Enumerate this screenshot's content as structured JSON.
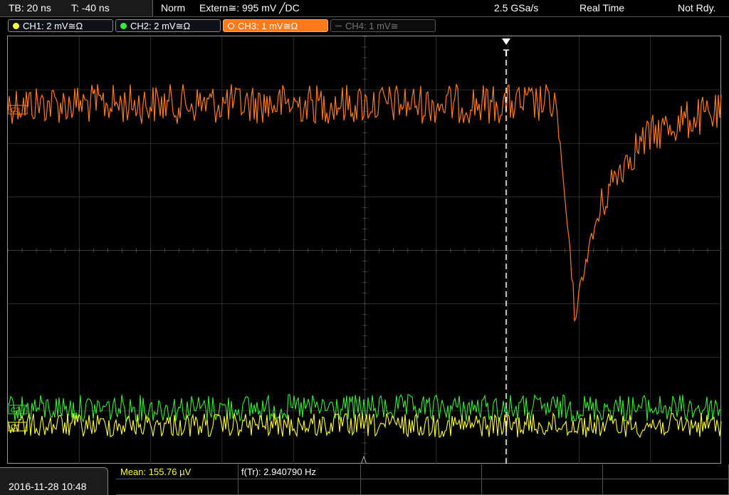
{
  "top": {
    "timebase": "TB: 20 ns",
    "trigger_time": "T: -40 ns",
    "mode": "Norm",
    "trigger": "Extern≅: 995 mV ╱DC",
    "sample_rate": "2.5 GSa/s",
    "acq_mode": "Real Time",
    "status": "Not Rdy."
  },
  "channels": [
    {
      "label": "CH1: 2 mV≅Ω",
      "color": "#ffff33",
      "state": "on"
    },
    {
      "label": "CH2: 2 mV≅Ω",
      "color": "#33ee33",
      "state": "on"
    },
    {
      "label": "CH3: 1 mV≅Ω",
      "color": "#ff7a1a",
      "state": "active"
    },
    {
      "label": "CH4: 1 mV≅",
      "color": "#777777",
      "state": "off"
    }
  ],
  "markers": {
    "trigger_marker": "T",
    "ch3_ref": "C3",
    "ch2_ref": "C2",
    "ch1_ref": "C1"
  },
  "measurements": {
    "mean": "Mean: 155.76 µV",
    "freq": "f(Tr): 2.940790 Hz"
  },
  "datetime": "2016-11-28 10:48",
  "colors": {
    "ch1": "#ffff33",
    "ch2": "#33ee33",
    "ch3": "#ff7a1a",
    "grid": "#3a3a3a"
  }
}
